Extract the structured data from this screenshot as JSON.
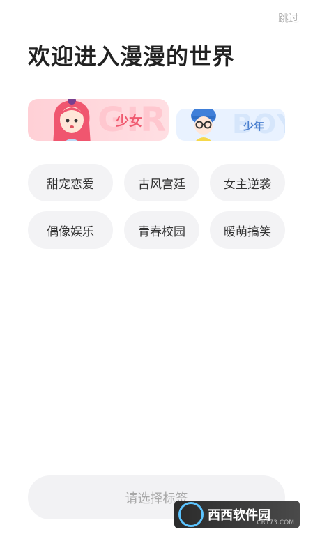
{
  "header": {
    "skip_label": "跳过",
    "title": "欢迎进入漫漫的世界"
  },
  "gender": {
    "girl": {
      "label": "少女",
      "bg_text": "GIRL",
      "accent": "#f05a70"
    },
    "boy": {
      "label": "少年",
      "bg_text": "BOY",
      "accent": "#4a7fcf"
    }
  },
  "tags": [
    {
      "label": "甜宠恋爱"
    },
    {
      "label": "古风宫廷"
    },
    {
      "label": "女主逆袭"
    },
    {
      "label": "偶像娱乐"
    },
    {
      "label": "青春校园"
    },
    {
      "label": "暖萌搞笑"
    }
  ],
  "footer": {
    "button_label": "请选择标签"
  },
  "watermark": {
    "text": "西西软件园",
    "sub": "CR173.COM"
  },
  "icons": {
    "girl_avatar": "girl-avatar-icon",
    "boy_avatar": "boy-avatar-icon"
  }
}
